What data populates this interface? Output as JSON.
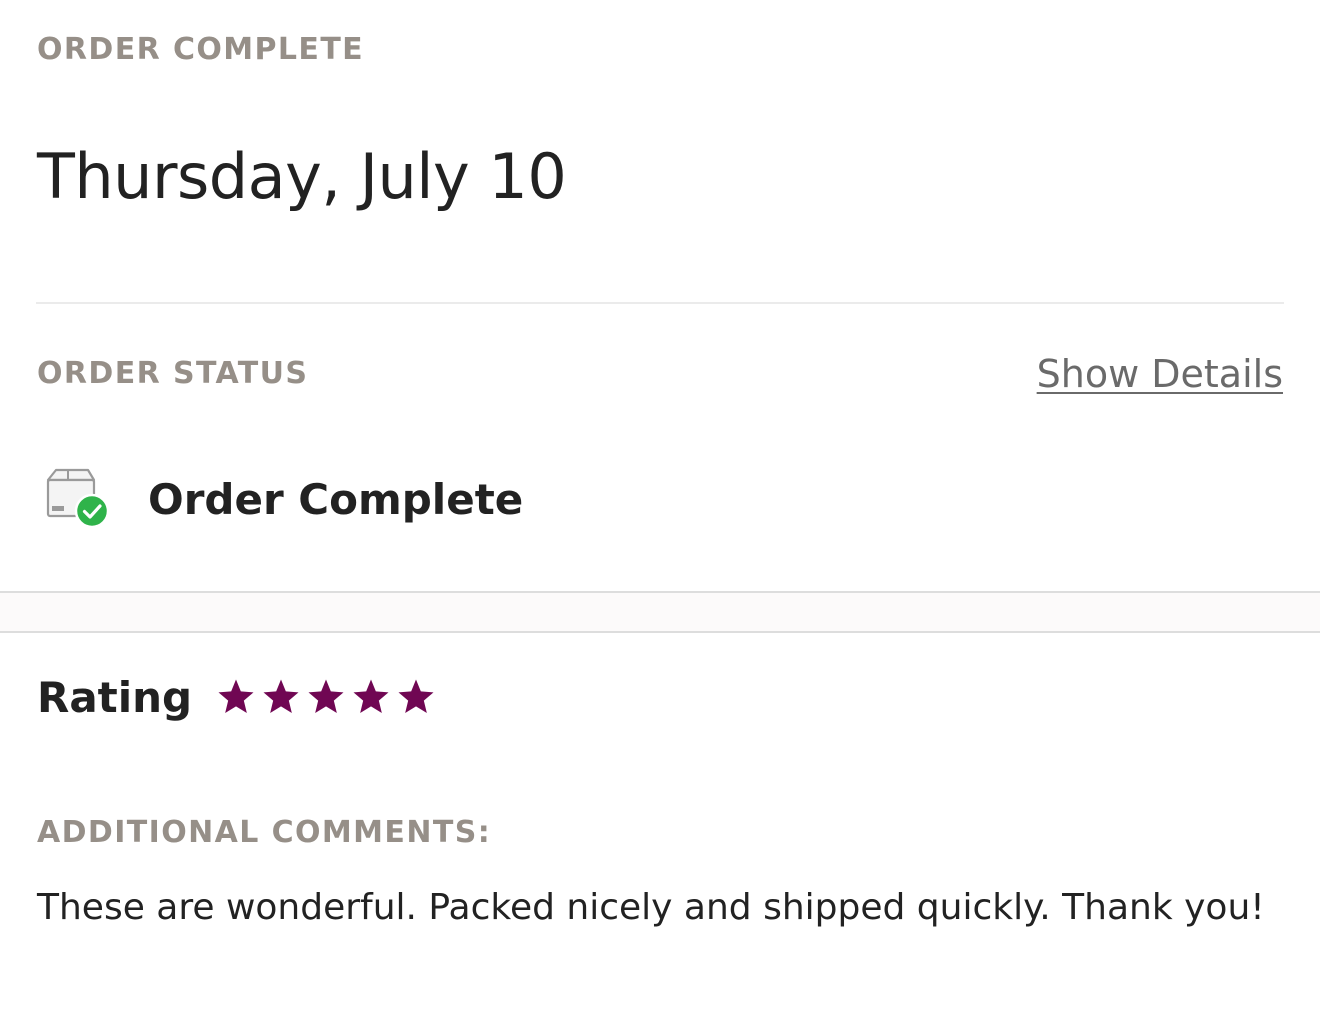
{
  "header": {
    "eyebrow": "ORDER COMPLETE",
    "date": "Thursday, July 10"
  },
  "order_status": {
    "heading": "ORDER STATUS",
    "show_details_label": "Show Details",
    "status_text": "Order Complete",
    "status_icon": "package-check-icon",
    "check_color": "#2fb34a"
  },
  "rating": {
    "label": "Rating",
    "stars": 5,
    "max_stars": 5,
    "star_color": "#700753"
  },
  "comments": {
    "heading": "ADDITIONAL COMMENTS:",
    "text": "These are wonderful. Packed nicely and shipped quickly. Thank you!"
  }
}
